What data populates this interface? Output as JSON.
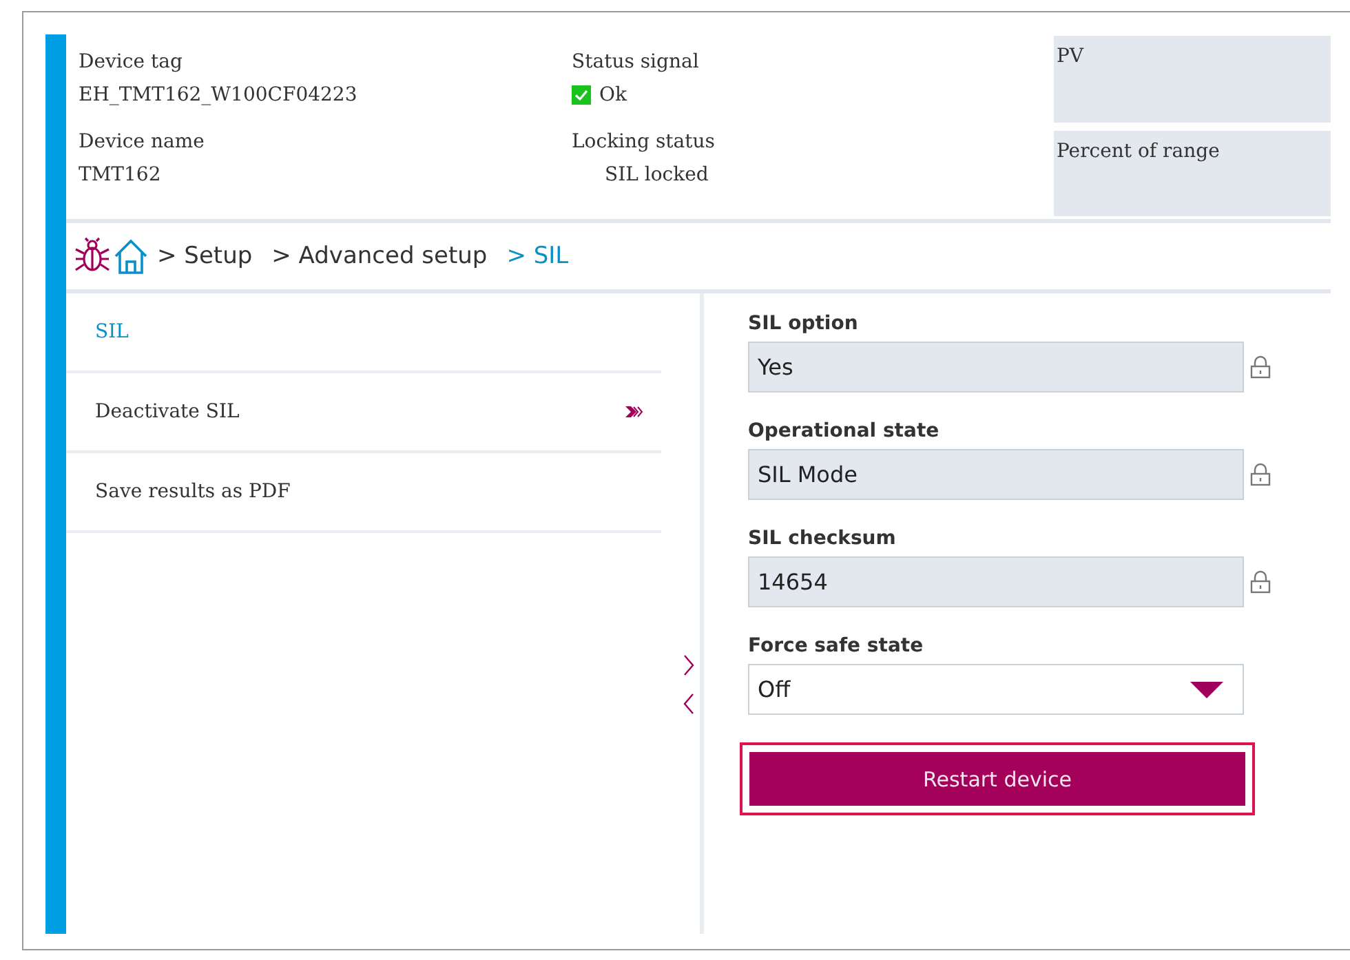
{
  "header": {
    "device_tag": {
      "label": "Device tag",
      "value": "EH_TMT162_W100CF04223"
    },
    "device_name": {
      "label": "Device name",
      "value": "TMT162"
    },
    "status_signal": {
      "label": "Status signal",
      "value": "Ok"
    },
    "locking_status": {
      "label": "Locking status",
      "value": "SIL locked"
    },
    "values": [
      {
        "label": "PV"
      },
      {
        "label": "Percent of range"
      }
    ]
  },
  "breadcrumb": [
    {
      "label": "> Setup",
      "selected": false
    },
    {
      "label": "> Advanced setup",
      "selected": false
    },
    {
      "label": "> SIL",
      "selected": true
    }
  ],
  "menu": [
    {
      "label": "SIL",
      "selected": true,
      "has_submenu": false
    },
    {
      "label": "Deactivate SIL",
      "selected": false,
      "has_submenu": true
    },
    {
      "label": "Save results as PDF",
      "selected": false,
      "has_submenu": false
    }
  ],
  "parameters": [
    {
      "kind": "locked",
      "label": "SIL option",
      "value": "Yes"
    },
    {
      "kind": "locked",
      "label": "Operational state",
      "value": "SIL Mode"
    },
    {
      "kind": "locked",
      "label": "SIL checksum",
      "value": "14654"
    },
    {
      "kind": "dropdown",
      "label": "Force safe state",
      "value": "Off"
    },
    {
      "kind": "button",
      "label": "Restart device",
      "highlighted": true
    }
  ]
}
